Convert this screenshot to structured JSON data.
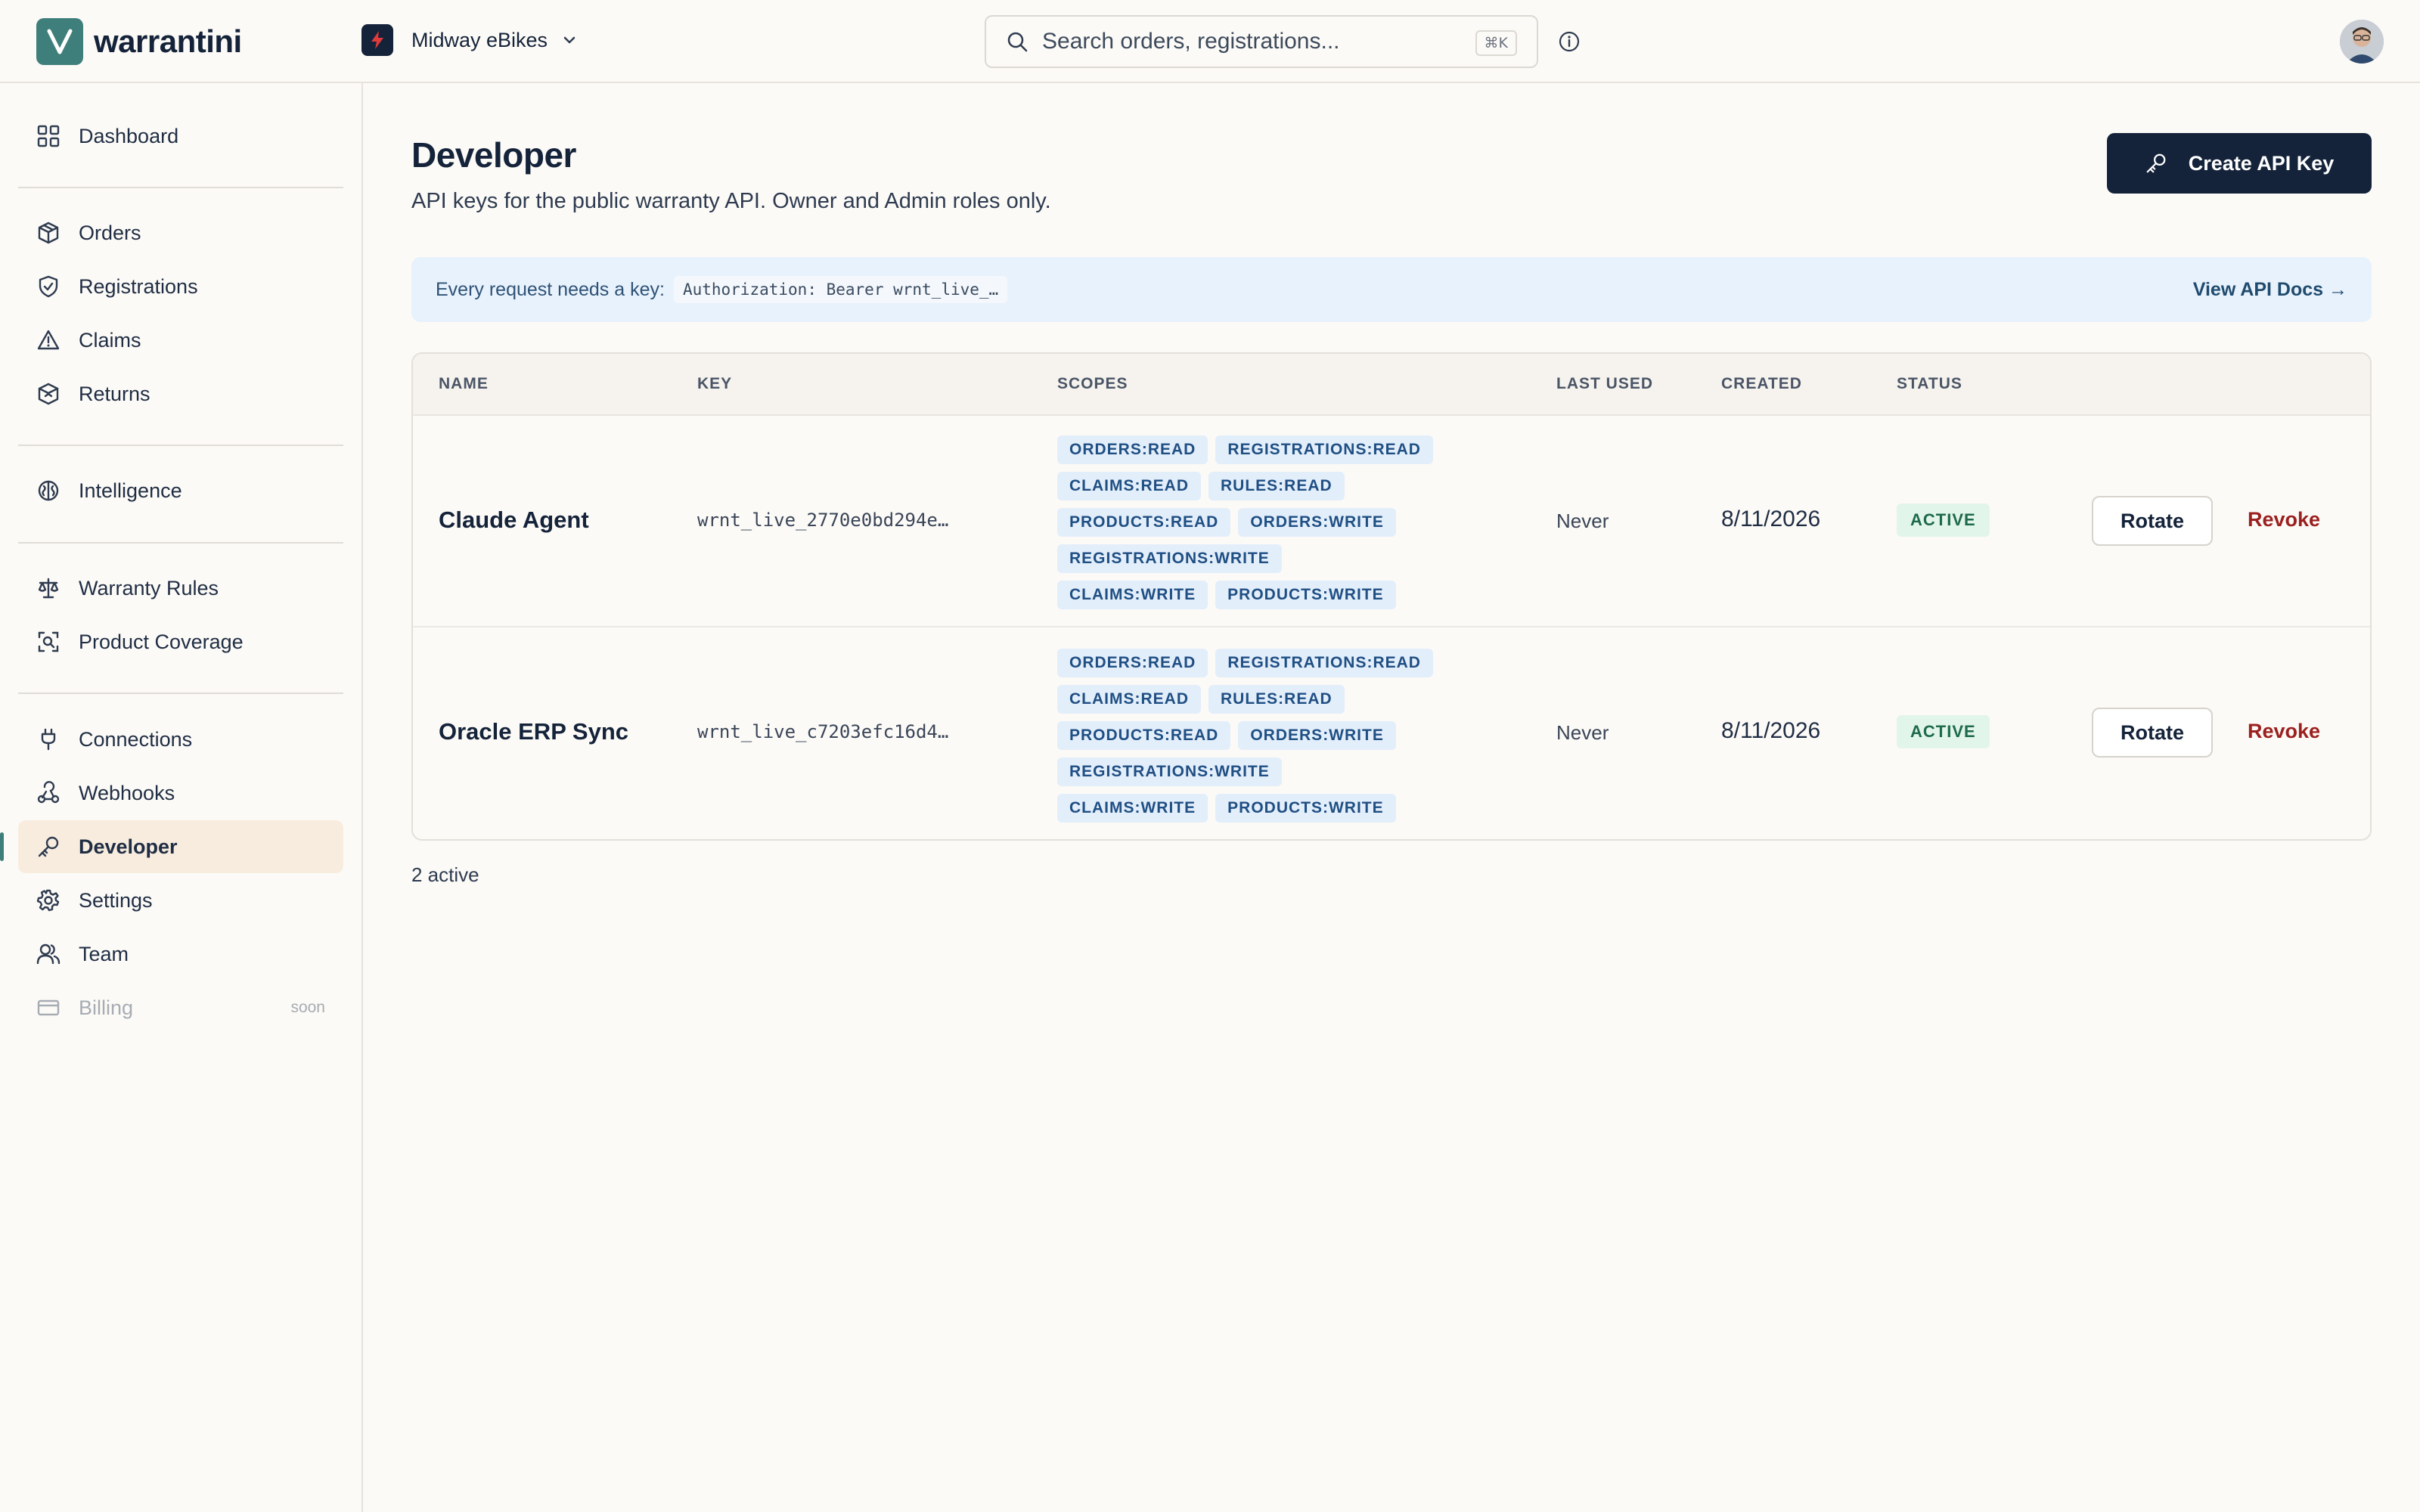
{
  "app": {
    "name": "warrantini",
    "workspace": "Midway eBikes",
    "search_placeholder": "Search orders, registrations...",
    "search_shortcut": "⌘K"
  },
  "sidebar": {
    "dashboard": "Dashboard",
    "orders": "Orders",
    "registrations": "Registrations",
    "claims": "Claims",
    "returns": "Returns",
    "intelligence": "Intelligence",
    "warranty_rules": "Warranty Rules",
    "product_coverage": "Product Coverage",
    "connections": "Connections",
    "webhooks": "Webhooks",
    "developer": "Developer",
    "settings": "Settings",
    "team": "Team",
    "billing": "Billing",
    "billing_badge": "soon"
  },
  "page": {
    "title": "Developer",
    "subtitle": "API keys for the public warranty API. Owner and Admin roles only.",
    "create_button": "Create API Key"
  },
  "banner": {
    "text": "Every request needs a key:",
    "code": "Authorization: Bearer wrnt_live_…",
    "link": "View API Docs →"
  },
  "table": {
    "headers": {
      "name": "NAME",
      "key": "KEY",
      "scopes": "SCOPES",
      "last_used": "LAST USED",
      "created": "CREATED",
      "status": "STATUS"
    },
    "rows": [
      {
        "name": "Claude Agent",
        "key": "wrnt_live_2770e0bd294e…",
        "scopes": [
          "ORDERS:READ",
          "REGISTRATIONS:READ",
          "CLAIMS:READ",
          "RULES:READ",
          "PRODUCTS:READ",
          "ORDERS:WRITE",
          "REGISTRATIONS:WRITE",
          "CLAIMS:WRITE",
          "PRODUCTS:WRITE"
        ],
        "last_used": "Never",
        "created": "8/11/2026",
        "status": "ACTIVE",
        "rotate": "Rotate",
        "revoke": "Revoke"
      },
      {
        "name": "Oracle ERP Sync",
        "key": "wrnt_live_c7203efc16d4…",
        "scopes": [
          "ORDERS:READ",
          "REGISTRATIONS:READ",
          "CLAIMS:READ",
          "RULES:READ",
          "PRODUCTS:READ",
          "ORDERS:WRITE",
          "REGISTRATIONS:WRITE",
          "CLAIMS:WRITE",
          "PRODUCTS:WRITE"
        ],
        "last_used": "Never",
        "created": "8/11/2026",
        "status": "ACTIVE",
        "rotate": "Rotate",
        "revoke": "Revoke"
      }
    ]
  },
  "summary": "2 active",
  "colors": {
    "brand_teal": "#3f7f7b",
    "navy": "#14233a",
    "active_nav_bg": "#f8ecde",
    "revoke_red": "#9b2020",
    "scope_chip_bg": "#e3eefb",
    "status_bg": "#e2f5ea"
  }
}
